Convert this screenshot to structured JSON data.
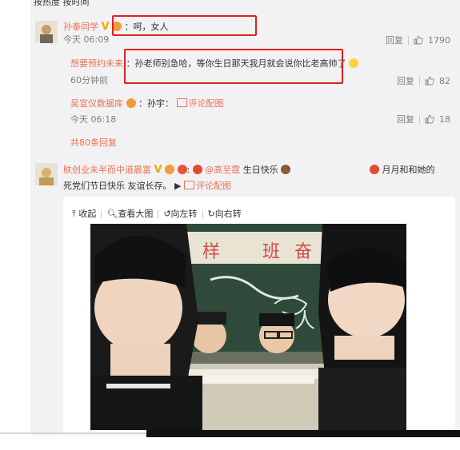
{
  "top_fragment": "按热度  按时间",
  "comment1": {
    "username": "孙泰同学",
    "text": "：呵，女人",
    "time": "今天 06:09",
    "reply_label": "回复",
    "likes": "1790"
  },
  "reply1": {
    "username": "想要预约未来",
    "text": "：孙老师别急哈，等你生日那天我月就会说你比老高帅了",
    "time": "60分钟前",
    "reply_label": "回复",
    "likes": "82"
  },
  "reply2": {
    "username": "吴宣仪数据库",
    "text": "：孙宇：",
    "link": "评论配图",
    "time": "今天 06:18",
    "reply_label": "回复",
    "likes": "18"
  },
  "more_replies": "共80条回复",
  "comment2": {
    "username": "肤创业未半而中道晨富",
    "mention": "@高至霆",
    "text": "生日快乐",
    "right_tag": "月月和和她的",
    "line2": "死党们节日快乐 友谊长存。",
    "link": "评论配图"
  },
  "image_toolbar": {
    "collapse": "收起",
    "view_large": "查看大图",
    "rotate_left": "向左转",
    "rotate_right": "向右转"
  },
  "photo_board_text": [
    "样",
    "班",
    "奋",
    "人"
  ],
  "colors": {
    "accent": "#eb7350",
    "highlight_box": "#e02020",
    "panel_bg": "#f2f2f5"
  }
}
